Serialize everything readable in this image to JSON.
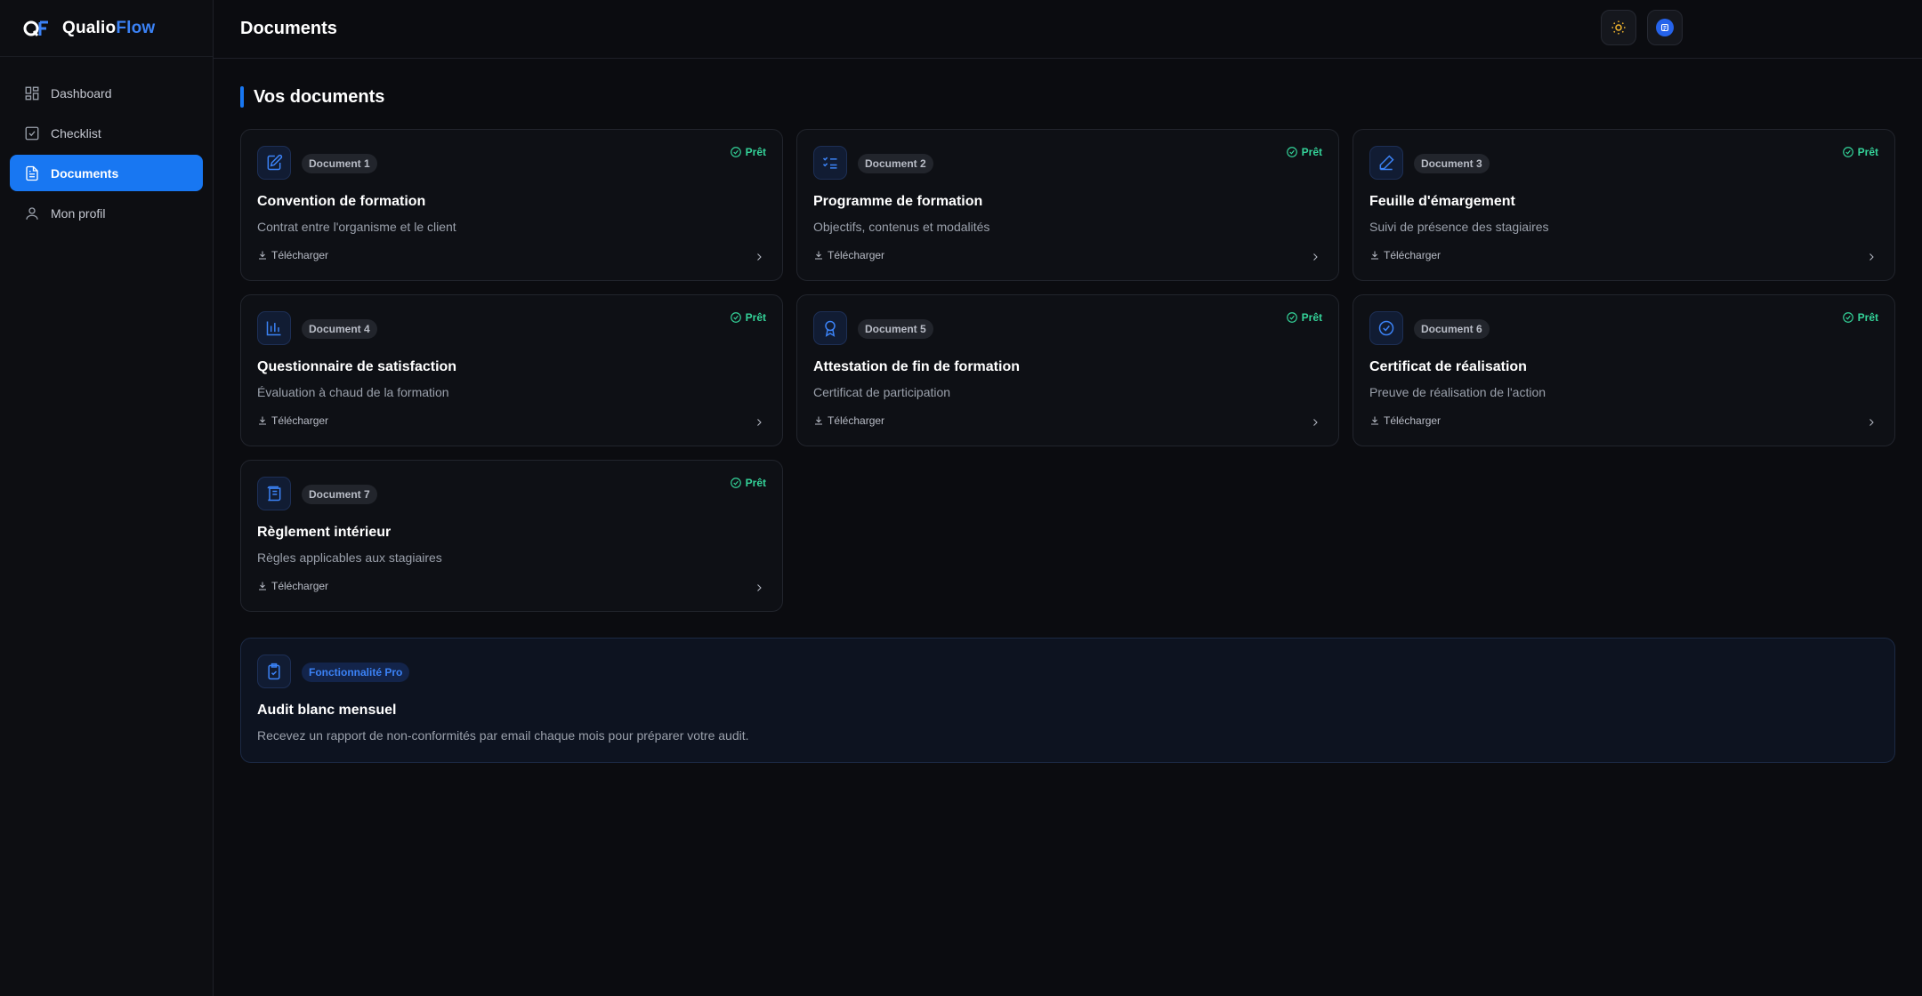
{
  "app": {
    "brand_prefix": "Qualio",
    "brand_suffix": "Flow",
    "logo_text": "QF"
  },
  "sidebar": {
    "items": [
      {
        "label": "Dashboard",
        "icon": "dashboard-icon",
        "active": false
      },
      {
        "label": "Checklist",
        "icon": "checklist-icon",
        "active": false
      },
      {
        "label": "Documents",
        "icon": "document-icon",
        "active": true
      },
      {
        "label": "Mon profil",
        "icon": "user-icon",
        "active": false
      }
    ]
  },
  "header": {
    "title": "Documents",
    "theme_toggle_icon": "sun-icon",
    "avatar_icon": "avatar-icon"
  },
  "main": {
    "section_title": "Vos documents",
    "download_label": "Télécharger",
    "status_label": "Prêt",
    "documents": [
      {
        "badge": "Document 1",
        "title": "Convention de formation",
        "desc": "Contrat entre l'organisme et le client",
        "icon": "file-edit-icon"
      },
      {
        "badge": "Document 2",
        "title": "Programme de formation",
        "desc": "Objectifs, contenus et modalités",
        "icon": "list-checks-icon"
      },
      {
        "badge": "Document 3",
        "title": "Feuille d'émargement",
        "desc": "Suivi de présence des stagiaires",
        "icon": "pen-icon"
      },
      {
        "badge": "Document 4",
        "title": "Questionnaire de satisfaction",
        "desc": "Évaluation à chaud de la formation",
        "icon": "bar-chart-icon"
      },
      {
        "badge": "Document 5",
        "title": "Attestation de fin de formation",
        "desc": "Certificat de participation",
        "icon": "award-icon"
      },
      {
        "badge": "Document 6",
        "title": "Certificat de réalisation",
        "desc": "Preuve de réalisation de l'action",
        "icon": "check-circle-icon"
      },
      {
        "badge": "Document 7",
        "title": "Règlement intérieur",
        "desc": "Règles applicables aux stagiaires",
        "icon": "scroll-icon"
      }
    ],
    "pro": {
      "badge": "Fonctionnalité Pro",
      "title": "Audit blanc mensuel",
      "desc": "Recevez un rapport de non-conformités par email chaque mois pour préparer votre audit.",
      "icon": "clipboard-check-icon"
    }
  },
  "colors": {
    "accent": "#1877f2",
    "status_ready": "#34d399",
    "background": "#0b0c10"
  }
}
